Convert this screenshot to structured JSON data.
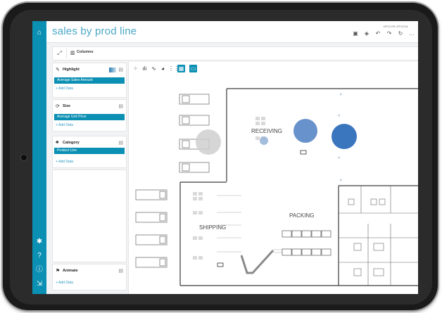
{
  "app": {
    "title": "sales by prod line",
    "collaborators": "EPICOR EPICSA"
  },
  "header_actions": [
    {
      "name": "save-icon",
      "glyph": "🖫"
    },
    {
      "name": "erase-icon",
      "glyph": "✐"
    },
    {
      "name": "undo-icon",
      "glyph": "↶"
    },
    {
      "name": "redo-icon",
      "glyph": "↷"
    },
    {
      "name": "refresh-icon",
      "glyph": "↻"
    },
    {
      "name": "more-icon",
      "glyph": "…"
    }
  ],
  "toolbar": {
    "columns_label": "Columns",
    "expand_icon": "expand-icon",
    "columns_icon": "columns-icon"
  },
  "left_nav": {
    "top_icon": "home-icon",
    "bottom_icons": [
      "settings-icon",
      "help-icon",
      "info-icon",
      "logout-icon"
    ]
  },
  "panels": {
    "highlight": {
      "title": "Highlight",
      "field": "Average Sales Amount",
      "add": "+ Add Data",
      "icon": "highlighter-icon"
    },
    "size": {
      "title": "Size",
      "field": "Average Unit Price",
      "add": "+ Add Data",
      "icon": "size-icon"
    },
    "category": {
      "title": "Category",
      "field": "Product Line",
      "add": "+ Add Data",
      "icon": "category-icon"
    },
    "animate": {
      "title": "Animate",
      "add": "+ Add Data",
      "icon": "animate-icon"
    }
  },
  "viz_types": [
    "scatter-icon",
    "bar-chart-icon",
    "line-chart-icon",
    "pie-chart-icon",
    "grid-icon",
    "map-icon",
    "image-icon"
  ],
  "floorplan": {
    "labels": {
      "receiving": "RECEIVING",
      "packing": "PACKING",
      "shipping": "SHIPPING"
    },
    "bubble_colors": {
      "dark": "#2f6fba",
      "mid": "#4d7fc2",
      "gray": "#cfcfcf",
      "light": "#9ab6d9"
    }
  },
  "colors": {
    "accent": "#0b8fb3",
    "title": "#4aa7c7"
  }
}
